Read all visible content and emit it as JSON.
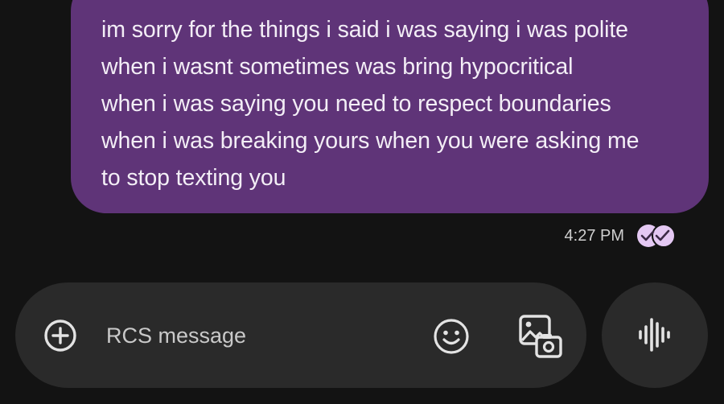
{
  "message": {
    "text": "im sorry for the things i said i was saying i was polite\nwhen i wasnt sometimes was bring hypocritical\nwhen i was saying you need to respect boundaries\nwhen i was breaking yours when you were asking me\nto stop texting you",
    "timestamp": "4:27 PM",
    "status_icon": "read-receipt-icon"
  },
  "compose": {
    "placeholder": "RCS message",
    "icons": {
      "add": "add-circle-icon",
      "emoji": "emoji-icon",
      "gallery": "gallery-camera-icon",
      "voice": "voice-waveform-icon"
    }
  },
  "colors": {
    "background": "#131313",
    "bubble": "#5f3478",
    "bubble_text": "#f3eef6",
    "compose_bar": "#2a2a2a",
    "read_receipt": "#e4c8f3"
  }
}
